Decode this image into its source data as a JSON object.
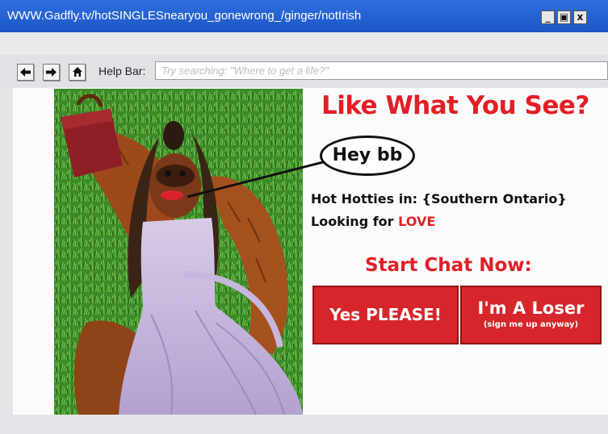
{
  "window": {
    "title": "WWW.Gadfly.tv/hotSINGLESnearyou_gonewrong_/ginger/notIrish",
    "controls": {
      "minimize": "_",
      "maximize": "▣",
      "close": "x"
    },
    "titlebar_color": "#1f5fd6"
  },
  "toolbar": {
    "back_icon": "left-arrow-icon",
    "forward_icon": "right-arrow-icon",
    "home_icon": "home-icon",
    "help_label": "Help Bar:",
    "search_placeholder": "Try searching: \"Where to get a life?\"",
    "search_value": ""
  },
  "ad": {
    "headline": "Like What You See?",
    "speech_bubble": "Hey bb",
    "hotties_line": "Hot Hotties in: {Southern Ontario}",
    "looking_prefix": "Looking for ",
    "looking_highlight": "LOVE",
    "start_chat": "Start Chat Now:",
    "yes_button": "Yes PLEASE!",
    "loser_button": "I'm A Loser",
    "loser_subtext": "(sign me up anyway)",
    "accent_color": "#e21f26",
    "button_color": "#d6262b",
    "photo_description": "orangutan-in-dress-photo"
  }
}
